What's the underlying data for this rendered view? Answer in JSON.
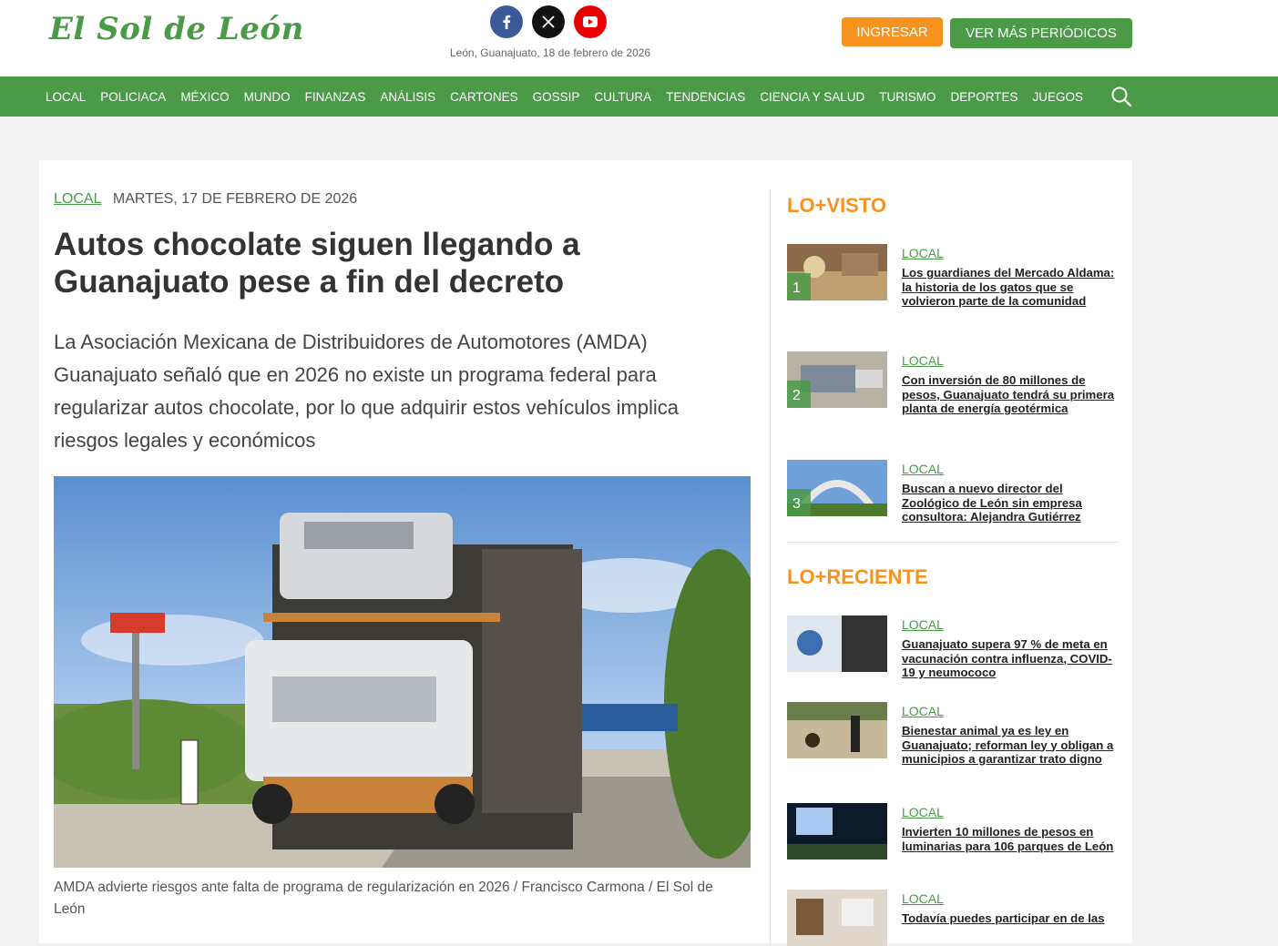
{
  "header": {
    "logo": "El Sol de León",
    "dateline": "León, Guanajuato, 18 de febrero de 2026",
    "login_label": "INGRESAR",
    "more_label": "VER MÁS PERIÓDICOS",
    "social": [
      "facebook-icon",
      "x-icon",
      "youtube-icon"
    ]
  },
  "nav": {
    "items": [
      "LOCAL",
      "POLICIACA",
      "MÉXICO",
      "MUNDO",
      "FINANZAS",
      "ANÁLISIS",
      "CARTONES",
      "GOSSIP",
      "CULTURA",
      "TENDENCIAS",
      "CIENCIA Y SALUD",
      "TURISMO",
      "DEPORTES",
      "JUEGOS"
    ]
  },
  "article": {
    "section": "LOCAL",
    "date": "MARTES, 17 DE FEBRERO DE 2026",
    "headline": "Autos chocolate siguen llegando a Guanajuato pese a fin del decreto",
    "lede": "La Asociación Mexicana de Distribuidores de Automotores (AMDA) Guanajuato señaló que en 2026 no existe un programa federal para regularizar autos chocolate, por lo que adquirir estos vehículos implica riesgos legales y económicos",
    "caption": "AMDA advierte riesgos ante falta de programa de regularización en 2026 / Francisco Carmona / El Sol de León"
  },
  "most_viewed": {
    "heading": "LO+VISTO",
    "items": [
      {
        "rank": "1",
        "section": "LOCAL",
        "title": "Los guardianes del Mercado Aldama: la historia de los gatos que se volvieron parte de la comunidad"
      },
      {
        "rank": "2",
        "section": "LOCAL",
        "title": "Con inversión de 80 millones de pesos, Guanajuato tendrá su primera planta de energía geotérmica"
      },
      {
        "rank": "3",
        "section": "LOCAL",
        "title": "Buscan a nuevo director del Zoológico de León sin empresa consultora: Alejandra Gutiérrez"
      }
    ]
  },
  "recent": {
    "heading": "LO+RECIENTE",
    "items": [
      {
        "section": "LOCAL",
        "title": "Guanajuato supera 97 % de meta en vacunación contra influenza, COVID-19 y neumococo"
      },
      {
        "section": "LOCAL",
        "title": "Bienestar animal ya es ley en Guanajuato; reforman ley y obligan a municipios a garantizar trato digno"
      },
      {
        "section": "LOCAL",
        "title": "Invierten 10 millones de pesos en luminarias para 106 parques de León"
      },
      {
        "section": "LOCAL",
        "title": "Todavía puedes participar en de las"
      }
    ]
  },
  "colors": {
    "brand_green": "#4a9a48",
    "accent_orange": "#f6921e"
  }
}
